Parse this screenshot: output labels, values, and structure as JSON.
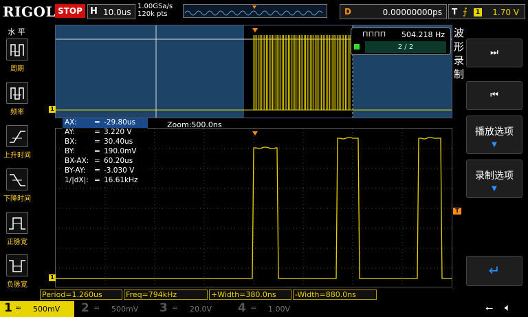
{
  "brand": "RIGOL",
  "run_state": "STOP",
  "timebase": {
    "key": "H",
    "value": "10.0us"
  },
  "sample": {
    "rate": "1.00GSa/s",
    "points": "120k pts"
  },
  "delay": {
    "key": "D",
    "value": "0.00000000ps"
  },
  "trigger": {
    "key": "T",
    "source": "1",
    "level": "1.70 V"
  },
  "left_menu": {
    "header": "水 平",
    "items": [
      {
        "label": "周期"
      },
      {
        "label": "频率"
      },
      {
        "label": "上升时间"
      },
      {
        "label": "下降时间"
      },
      {
        "label": "正脉宽"
      },
      {
        "label": "负脉宽"
      }
    ]
  },
  "right_menu": {
    "header": [
      "波",
      "形",
      "录",
      "制"
    ],
    "play_options": "播放选项",
    "record_options": "录制选项"
  },
  "record_panel": {
    "frequency": "504.218 Hz",
    "frame": "2 / 2"
  },
  "zoom_label": "Zoom:500.0ns",
  "cursor_readout": [
    {
      "name": "AX:",
      "value": "-29.80us"
    },
    {
      "name": "AY:",
      "value": "3.220 V"
    },
    {
      "name": "BX:",
      "value": "30.40us"
    },
    {
      "name": "BY:",
      "value": "190.0mV"
    },
    {
      "name": "BX-AX:",
      "value": "60.20us"
    },
    {
      "name": "BY-AY:",
      "value": "-3.030 V"
    },
    {
      "name": "1/|dX|:",
      "value": "16.61kHz"
    }
  ],
  "measurements": [
    {
      "label": "Period=1.260us"
    },
    {
      "label": "Freq=794kHz"
    },
    {
      "label": "+Width=380.0ns"
    },
    {
      "label": "-Width=880.0ns"
    }
  ],
  "channels": [
    {
      "num": "1",
      "scale": "500mV",
      "color": "#e8d400",
      "active": true
    },
    {
      "num": "2",
      "scale": "500mV",
      "color": "#1e90ff",
      "active": false
    },
    {
      "num": "3",
      "scale": "20.0V",
      "color": "#d040d0",
      "active": false
    },
    {
      "num": "4",
      "scale": "1.00V",
      "color": "#2f7fff",
      "active": false
    }
  ],
  "markers": {
    "channel_marker": "1",
    "trigger_marker": "T"
  }
}
